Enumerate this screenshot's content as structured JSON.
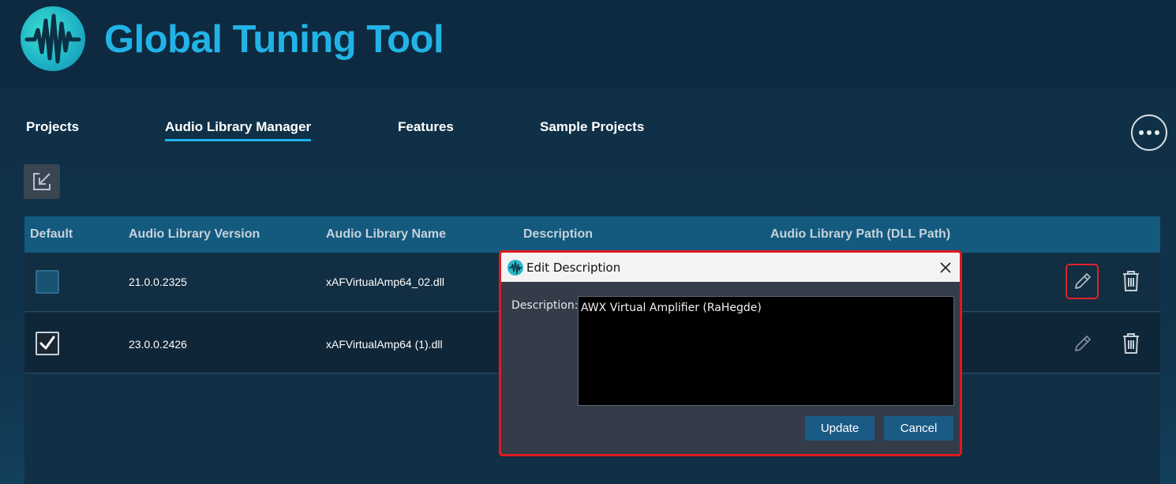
{
  "app": {
    "title": "Global Tuning Tool",
    "logo_icon": "waveform-logo-icon"
  },
  "nav": {
    "tabs": [
      {
        "label": "Projects",
        "active": false
      },
      {
        "label": "Audio Library Manager",
        "active": true
      },
      {
        "label": "Features",
        "active": false
      },
      {
        "label": "Sample Projects",
        "active": false
      }
    ],
    "more_icon": "ellipsis-icon"
  },
  "toolbar": {
    "import_icon": "import-icon"
  },
  "table": {
    "headers": [
      "Default",
      "Audio Library Version",
      "Audio Library Name",
      "Description",
      "Audio Library Path (DLL Path)"
    ],
    "rows": [
      {
        "default": false,
        "version": "21.0.0.2325",
        "name": "xAFVirtualAmp64_02.dll",
        "description": "",
        "path": ""
      },
      {
        "default": true,
        "version": "23.0.0.2426",
        "name": "xAFVirtualAmp64 (1).dll",
        "description": "",
        "path": ""
      }
    ],
    "edit_icon": "pencil-icon",
    "delete_icon": "trash-icon"
  },
  "dialog": {
    "title": "Edit Description",
    "label": "Description:",
    "value": "AWX Virtual Amplifier (RaHegde)",
    "update_label": "Update",
    "cancel_label": "Cancel",
    "close_icon": "close-icon"
  },
  "colors": {
    "accent": "#1eb2ee",
    "title_blue": "#22b3e6",
    "header_row": "#145a7e",
    "highlight_red": "#e3202a",
    "dialog_button": "#1a5b86"
  }
}
